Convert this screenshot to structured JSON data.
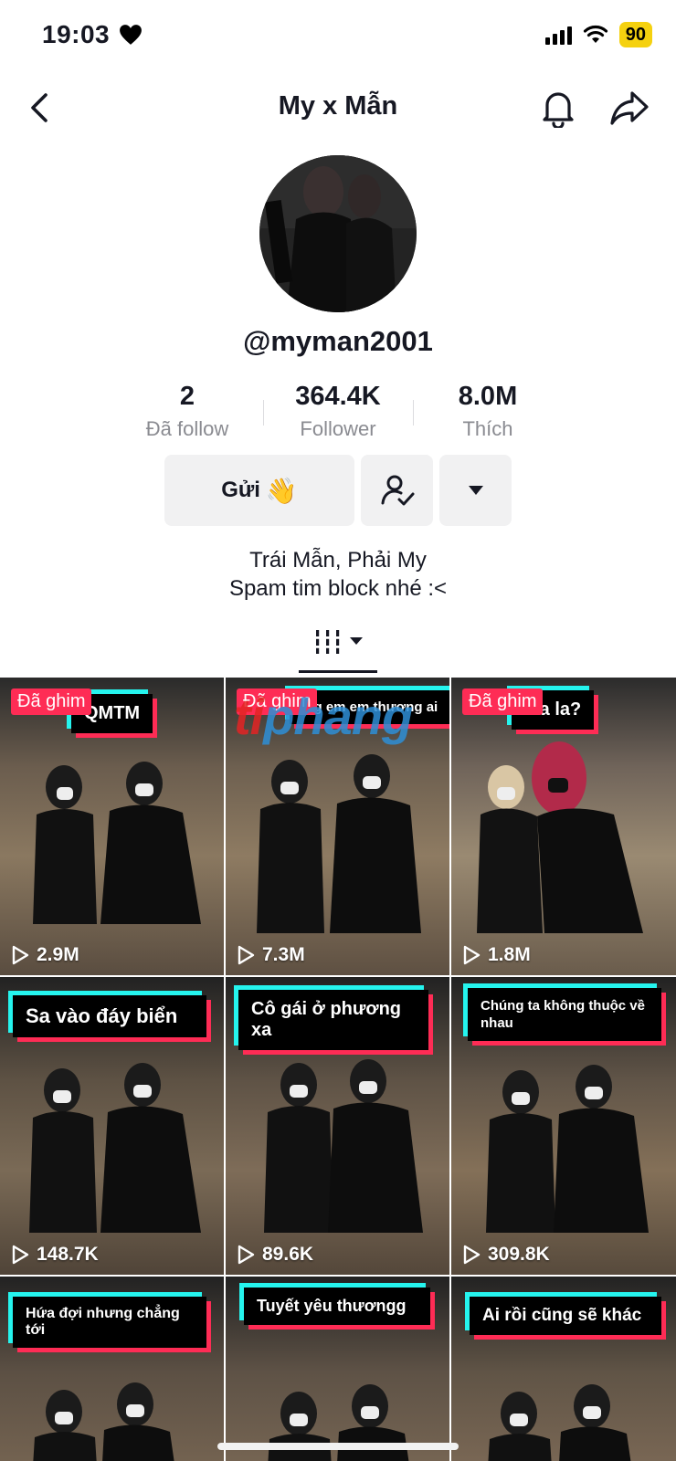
{
  "status_bar": {
    "time": "19:03",
    "battery": "90",
    "battery_color": "#f5d10f"
  },
  "nav": {
    "title": "My x Mẫn"
  },
  "profile": {
    "username": "@myman2001",
    "stats": [
      {
        "value": "2",
        "label": "Đã follow"
      },
      {
        "value": "364.4K",
        "label": "Follower"
      },
      {
        "value": "8.0M",
        "label": "Thích"
      }
    ],
    "send_button": "Gửi",
    "send_emoji": "👋",
    "bio_lines": [
      "Trái Mẫn, Phải My",
      "Spam tim block nhé :<"
    ]
  },
  "watermark": {
    "part1": "ti",
    "part2": "phang"
  },
  "videos": [
    {
      "caption": "QMTM",
      "pinned": true,
      "pin_label": "Đã ghim",
      "views": "2.9M"
    },
    {
      "caption": "...g em em thương ai",
      "pinned": true,
      "pin_label": "Đã ghim",
      "views": "7.3M"
    },
    {
      "caption": "...a la?",
      "pinned": true,
      "pin_label": "Đã ghim",
      "views": "1.8M"
    },
    {
      "caption": "Sa vào đáy biển",
      "pinned": false,
      "views": "148.7K"
    },
    {
      "caption": "Cô gái ở phương xa",
      "pinned": false,
      "views": "89.6K"
    },
    {
      "caption": "Chúng ta không thuộc về nhau",
      "pinned": false,
      "views": "309.8K"
    },
    {
      "caption": "Hứa đợi nhưng chẳng tới",
      "pinned": false,
      "views": ""
    },
    {
      "caption": "Tuyết yêu thươngg",
      "pinned": false,
      "views": ""
    },
    {
      "caption": "Ai rồi cũng sẽ khác",
      "pinned": false,
      "views": ""
    }
  ],
  "colors": {
    "accent_red": "#fe2c55",
    "accent_cyan": "#25f4ee",
    "text_primary": "#161823",
    "text_secondary": "#8a8b91"
  }
}
